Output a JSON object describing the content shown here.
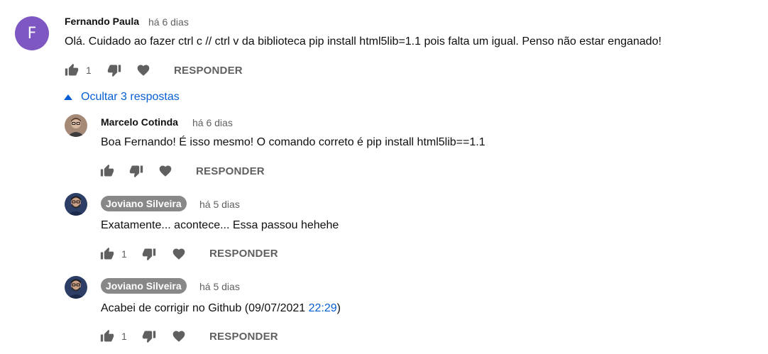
{
  "comment": {
    "avatar_letter": "F",
    "avatar_color": "#7e57c2",
    "author": "Fernando Paula",
    "time": "há 6 dias",
    "text": "Olá. Cuidado ao fazer ctrl c  // ctrl v da biblioteca pip install html5lib=1.1 pois falta um igual. Penso não estar enganado!",
    "likes": "1",
    "reply_label": "RESPONDER"
  },
  "replies_toggle": {
    "label": "Ocultar 3 respostas",
    "icon": "caret-up-icon"
  },
  "replies": [
    {
      "author": "Marcelo Cotinda",
      "time": "há 6 dias",
      "text": "Boa Fernando! É isso mesmo! O comando correto é pip install html5lib==1.1",
      "likes": "",
      "reply_label": "RESPONDER"
    },
    {
      "author": "Joviano Silveira",
      "time": "há 5 dias",
      "text": "Exatamente... acontece... Essa passou hehehe",
      "likes": "1",
      "reply_label": "RESPONDER"
    },
    {
      "author": "Joviano Silveira",
      "time": "há 5 dias",
      "text": "Acabei de corrigir no Github (09/07/2021 ",
      "timestamp_link": "22:29",
      "text_suffix": ")",
      "likes": "1",
      "reply_label": "RESPONDER"
    }
  ],
  "colors": {
    "link": "#065fd4",
    "icon": "#606060",
    "badge": "#888888"
  }
}
